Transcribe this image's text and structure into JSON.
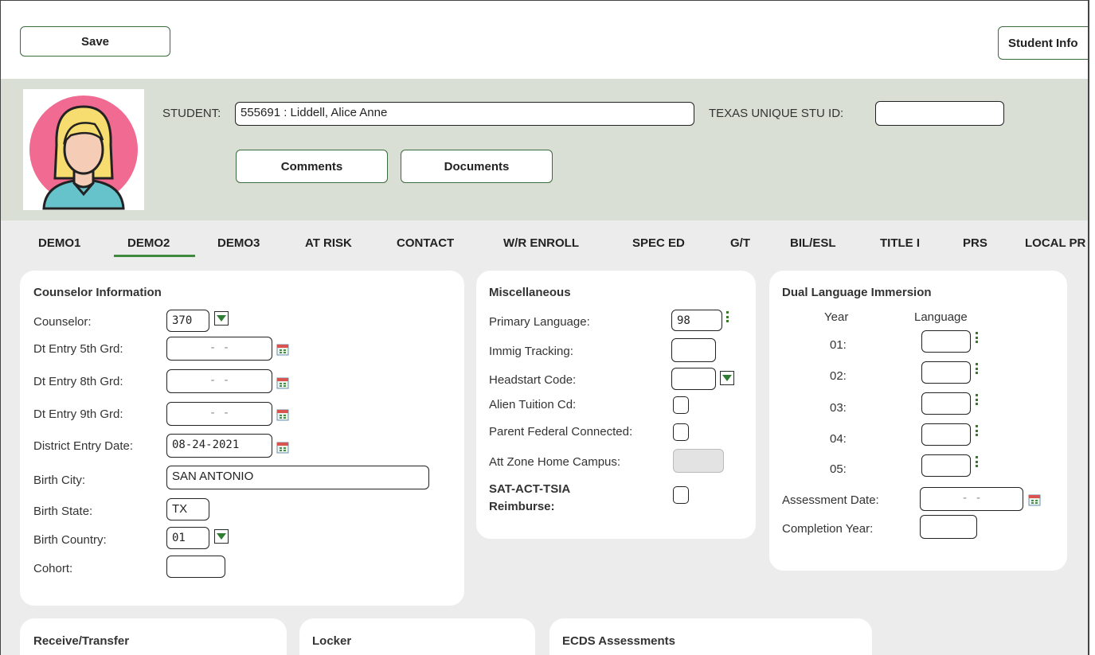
{
  "toolbar": {
    "save_label": "Save",
    "student_info_label": "Student Info"
  },
  "header": {
    "student_label": "STUDENT:",
    "student_value": "555691 : Liddell, Alice Anne",
    "texas_id_label": "TEXAS UNIQUE STU ID:",
    "texas_id_value": "",
    "comments_label": "Comments",
    "documents_label": "Documents"
  },
  "tabs": [
    {
      "label": "DEMO1"
    },
    {
      "label": "DEMO2",
      "active": true
    },
    {
      "label": "DEMO3"
    },
    {
      "label": "AT RISK"
    },
    {
      "label": "CONTACT"
    },
    {
      "label": "W/R ENROLL"
    },
    {
      "label": "SPEC ED"
    },
    {
      "label": "G/T"
    },
    {
      "label": "BIL/ESL"
    },
    {
      "label": "TITLE I"
    },
    {
      "label": "PRS"
    },
    {
      "label": "LOCAL PR"
    }
  ],
  "counselor": {
    "title": "Counselor Information",
    "counselor_label": "Counselor:",
    "counselor_value": "370",
    "dt5_label": "Dt Entry 5th Grd:",
    "dt5_value": "- -",
    "dt8_label": "Dt Entry 8th Grd:",
    "dt8_value": "- -",
    "dt9_label": "Dt Entry 9th Grd:",
    "dt9_value": "- -",
    "district_label": "District Entry Date:",
    "district_value": "08-24-2021",
    "birth_city_label": "Birth City:",
    "birth_city_value": "SAN ANTONIO",
    "birth_state_label": "Birth State:",
    "birth_state_value": "TX",
    "birth_country_label": "Birth Country:",
    "birth_country_value": "01",
    "cohort_label": "Cohort:",
    "cohort_value": ""
  },
  "misc": {
    "title": "Miscellaneous",
    "primary_lang_label": "Primary Language:",
    "primary_lang_value": "98",
    "immig_label": "Immig Tracking:",
    "headstart_label": "Headstart Code:",
    "alien_label": "Alien Tuition Cd:",
    "parent_fed_label": "Parent Federal Connected:",
    "att_zone_label": "Att Zone Home Campus:",
    "sat_label_1": "SAT-ACT-TSIA",
    "sat_label_2": "Reimburse:"
  },
  "dual": {
    "title": "Dual Language Immersion",
    "year_header": "Year",
    "language_header": "Language",
    "years": [
      "01:",
      "02:",
      "03:",
      "04:",
      "05:"
    ],
    "assessment_label": "Assessment Date:",
    "assessment_value": "- -",
    "completion_label": "Completion Year:"
  },
  "bottom": {
    "receive_title": "Receive/Transfer",
    "locker_title": "Locker",
    "ecds_title": "ECDS Assessments"
  },
  "colors": {
    "accent_green": "#3f8a3f",
    "banner": "#d9dfd5",
    "avatar_pink": "#f06a92"
  }
}
